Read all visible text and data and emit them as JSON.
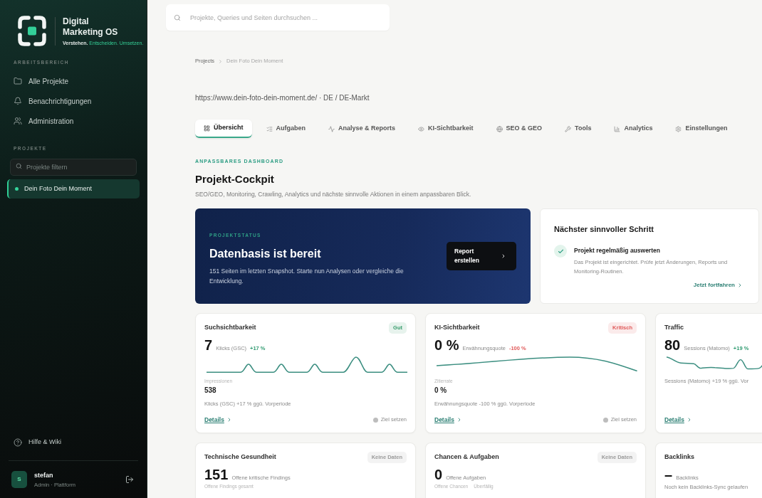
{
  "sidebar": {
    "brand": {
      "name": "Digital Marketing OS",
      "tagline": [
        {
          "text": "Verstehen.",
          "accent": false
        },
        {
          "text": "Entscheiden.",
          "accent": true
        },
        {
          "text": "Umsetzen.",
          "accent": true
        }
      ]
    },
    "workspace": {
      "title": "ARBEITSBEREICH",
      "items": [
        {
          "label": "Alle Projekte",
          "selected": false
        },
        {
          "label": "Benachrichtigungen",
          "selected": false
        },
        {
          "label": "Administration",
          "selected": false
        }
      ]
    },
    "projects": {
      "title": "PROJEKTE",
      "filter": {
        "placeholder": "Projekte filtern"
      },
      "items": [
        {
          "label": "Dein Foto Dein Moment",
          "selected": true
        }
      ]
    },
    "help": {
      "label": "Hilfe & Wiki"
    },
    "user": {
      "initial": "S",
      "name": "stefan",
      "role": "Admin · Plattform"
    }
  },
  "search": {
    "placeholder": "Projekte, Queries und Seiten durchsuchen ..."
  },
  "breadcrumb": [
    {
      "label": "Projects",
      "current": false
    },
    {
      "label": "Dein Foto Dein Moment",
      "current": true
    }
  ],
  "project": {
    "url": "https://www.dein-foto-dein-moment.de/ · DE / DE-Markt"
  },
  "tabs": [
    {
      "label": "Übersicht",
      "selected": true
    },
    {
      "label": "Aufgaben",
      "selected": false
    },
    {
      "label": "Analyse & Reports",
      "selected": false
    },
    {
      "label": "KI-Sichtbarkeit",
      "selected": false
    },
    {
      "label": "SEO & GEO",
      "selected": false
    },
    {
      "label": "Tools",
      "selected": false
    },
    {
      "label": "Analytics",
      "selected": false
    },
    {
      "label": "Einstellungen",
      "selected": false
    }
  ],
  "dashboard": {
    "eyebrow": "ANPASSBARES DASHBOARD",
    "title": "Projekt-Cockpit",
    "description": "SEO/GEO, Monitoring, Crawling, Analytics und nächste sinnvolle Aktionen in einem anpassbaren Blick."
  },
  "status_card": {
    "eyebrow": "PROJEKTSTATUS",
    "title": "Datenbasis ist bereit",
    "description": "151 Seiten im letzten Snapshot. Starte nun Analysen oder vergleiche die Entwicklung.",
    "button": "Report erstellen"
  },
  "next_step": {
    "title": "Nächster sinnvoller Schritt",
    "item": {
      "title": "Projekt regelmäßig auswerten",
      "description": "Das Projekt ist eingerichtet. Prüfe jetzt Änderungen, Reports und Monitoring-Routinen.",
      "done": true
    },
    "link": "Jetzt fortfahren"
  },
  "metric_cards": [
    {
      "title": "Suchsichtbarkeit",
      "badge": {
        "text": "Gut",
        "color": "#3a9d6e"
      },
      "value": "7",
      "unit": "Klicks (GSC)",
      "change": {
        "text": "+17 %",
        "color": "#2f9a70"
      },
      "sparkline": true,
      "secondary": [
        {
          "label": "Impressionen",
          "value": "538"
        }
      ],
      "note": "Klicks (GSC) +17 % ggü. Vorperiode",
      "details": "Details",
      "goal": "Ziel setzen"
    },
    {
      "title": "KI-Sichtbarkeit",
      "badge": {
        "text": "Kritisch",
        "color": "#e05a5a"
      },
      "value": "0 %",
      "unit": "Erwähnungsquote",
      "change": {
        "text": "-100 %",
        "color": "#e05a5a"
      },
      "sparkline": true,
      "secondary": [
        {
          "label": "Zitierrate",
          "value": "0 %"
        }
      ],
      "note": "Erwähnungsquote -100 % ggü. Vorperiode",
      "details": "Details",
      "goal": "Ziel setzen"
    },
    {
      "title": "Traffic",
      "value": "80",
      "unit": "Sessions (Matomo)",
      "change": {
        "text": "+19 %",
        "color": "#2f9a70"
      },
      "sparkline": true,
      "note": "Sessions (Matomo) +19 % ggü. Vor",
      "details": "Details"
    },
    {
      "title": "Technische Gesundheit",
      "badge": {
        "text": "Keine Daten",
        "color": "#9a9a9a"
      },
      "value": "151",
      "unit": "Offene kritische Findings",
      "secondary": [
        {
          "label": "Offene Findings gesamt"
        }
      ]
    },
    {
      "title": "Chancen & Aufgaben",
      "badge": {
        "text": "Keine Daten",
        "color": "#9a9a9a"
      },
      "value": "0",
      "unit": "Offene Aufgaben",
      "secondary": [
        {
          "label": "Offene Chancen"
        },
        {
          "label": "Überfällig"
        }
      ]
    },
    {
      "title": "Backlinks",
      "value": "–",
      "unit": "Backlinks",
      "note": "Noch kein Backlinks-Sync gelaufen"
    }
  ]
}
